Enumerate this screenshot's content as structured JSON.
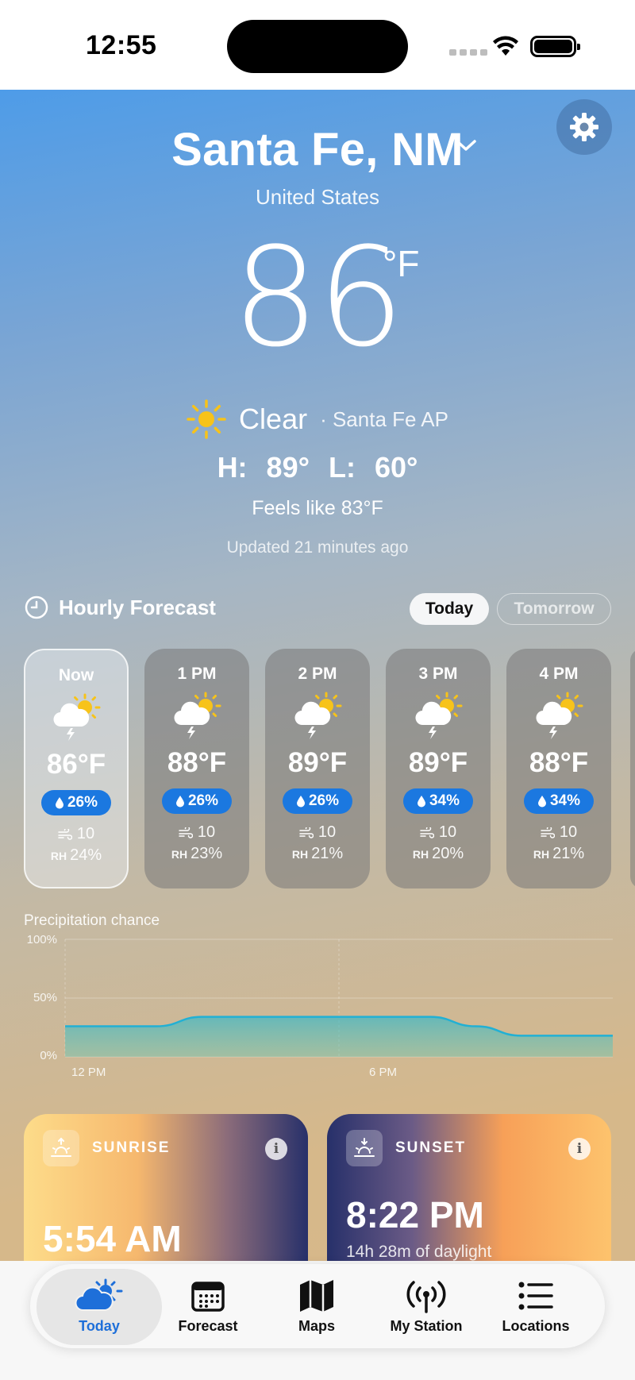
{
  "status_bar": {
    "time": "12:55"
  },
  "location": {
    "city": "Santa Fe, NM",
    "country": "United States"
  },
  "current": {
    "temperature": "86",
    "unit": "°F",
    "condition": "Clear",
    "station": "· Santa Fe AP",
    "high_low": "H: 89°   L: 60°",
    "feels_like": "Feels like 83°F",
    "updated": "Updated 21 minutes ago"
  },
  "hourly": {
    "title": "Hourly Forecast",
    "toggle": {
      "today": "Today",
      "tomorrow": "Tomorrow"
    },
    "cards": [
      {
        "time": "Now",
        "temp": "86°F",
        "precip": "26%",
        "wind": "10",
        "rh_label": "RH",
        "rh": "24%"
      },
      {
        "time": "1 PM",
        "temp": "88°F",
        "precip": "26%",
        "wind": "10",
        "rh_label": "RH",
        "rh": "23%"
      },
      {
        "time": "2 PM",
        "temp": "89°F",
        "precip": "26%",
        "wind": "10",
        "rh_label": "RH",
        "rh": "21%"
      },
      {
        "time": "3 PM",
        "temp": "89°F",
        "precip": "34%",
        "wind": "10",
        "rh_label": "RH",
        "rh": "20%"
      },
      {
        "time": "4 PM",
        "temp": "88°F",
        "precip": "34%",
        "wind": "10",
        "rh_label": "RH",
        "rh": "21%"
      }
    ]
  },
  "precip_chart": {
    "label": "Precipitation chance",
    "y_ticks": [
      "100%",
      "50%",
      "0%"
    ],
    "x_ticks": [
      "12 PM",
      "6 PM"
    ]
  },
  "chart_data": {
    "type": "area",
    "title": "Precipitation chance",
    "x": [
      0,
      1,
      2,
      3,
      4,
      5,
      6,
      7,
      8,
      9,
      10,
      11,
      12
    ],
    "x_tick_labels": {
      "0": "12 PM",
      "6": "6 PM"
    },
    "series": [
      {
        "values": [
          26,
          26,
          26,
          34,
          34,
          34,
          34,
          34,
          34,
          26,
          18,
          18,
          18
        ]
      }
    ],
    "ylim": [
      0,
      100
    ],
    "y_tick_labels": [
      "0%",
      "50%",
      "100%"
    ],
    "color": "#2ab4d6"
  },
  "sun": {
    "sunrise": {
      "title": "SUNRISE",
      "time": "5:54 AM"
    },
    "sunset": {
      "title": "SUNSET",
      "time": "8:22 PM",
      "daylight": "14h 28m of daylight"
    },
    "info_glyph": "i"
  },
  "tabs": [
    {
      "label": "Today",
      "icon": "cloud-sun-icon",
      "active": true
    },
    {
      "label": "Forecast",
      "icon": "calendar-icon",
      "active": false
    },
    {
      "label": "Maps",
      "icon": "map-icon",
      "active": false
    },
    {
      "label": "My Station",
      "icon": "antenna-icon",
      "active": false
    },
    {
      "label": "Locations",
      "icon": "list-icon",
      "active": false
    }
  ],
  "colors": {
    "accent": "#1e6fd9",
    "precip_pill": "#1b78e0",
    "sun_yellow": "#f7c31a"
  }
}
